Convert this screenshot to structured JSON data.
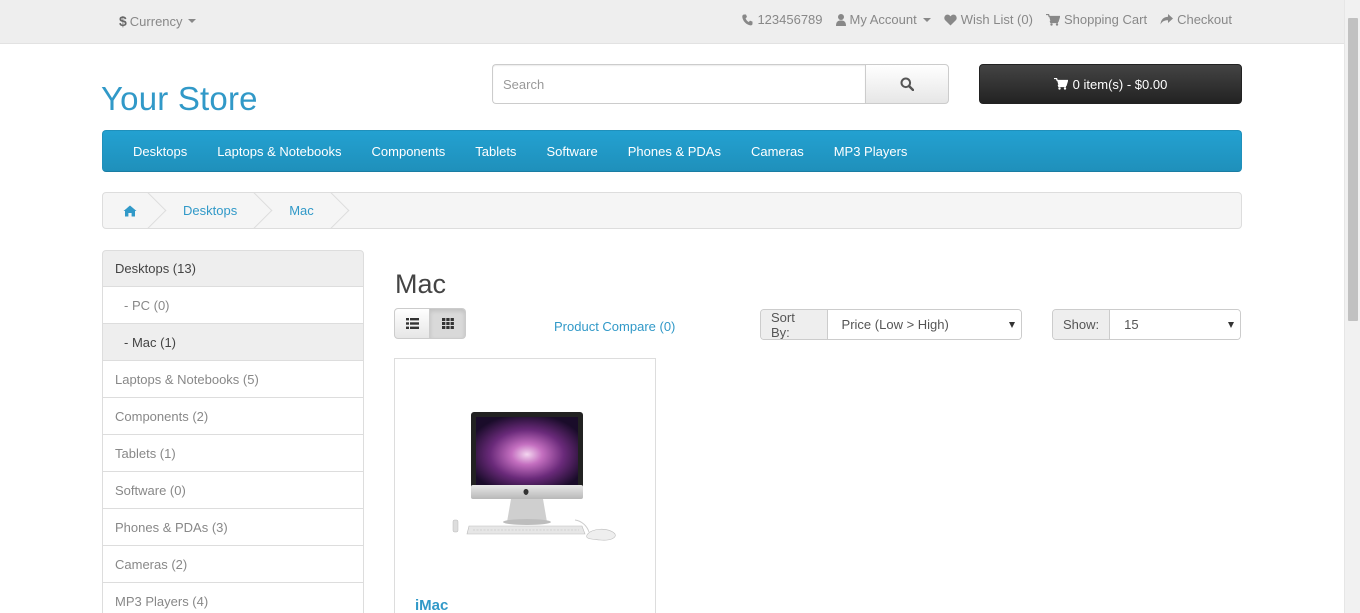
{
  "topbar": {
    "currency_symbol": "$",
    "currency_label": "Currency",
    "phone": "123456789",
    "my_account": "My Account",
    "wish_list": "Wish List (0)",
    "shopping_cart": "Shopping Cart",
    "checkout": "Checkout"
  },
  "header": {
    "logo": "Your Store",
    "search_placeholder": "Search",
    "cart_label": "0 item(s) - $0.00"
  },
  "menu": [
    "Desktops",
    "Laptops & Notebooks",
    "Components",
    "Tablets",
    "Software",
    "Phones & PDAs",
    "Cameras",
    "MP3 Players"
  ],
  "breadcrumb": [
    "Desktops",
    "Mac"
  ],
  "sidebar": [
    {
      "label": "Desktops (13)",
      "active": true,
      "sub": false
    },
    {
      "label": "- PC (0)",
      "active": false,
      "sub": true
    },
    {
      "label": "- Mac (1)",
      "active": true,
      "sub": true
    },
    {
      "label": "Laptops & Notebooks (5)",
      "active": false,
      "sub": false
    },
    {
      "label": "Components (2)",
      "active": false,
      "sub": false
    },
    {
      "label": "Tablets (1)",
      "active": false,
      "sub": false
    },
    {
      "label": "Software (0)",
      "active": false,
      "sub": false
    },
    {
      "label": "Phones & PDAs (3)",
      "active": false,
      "sub": false
    },
    {
      "label": "Cameras (2)",
      "active": false,
      "sub": false
    },
    {
      "label": "MP3 Players (4)",
      "active": false,
      "sub": false
    }
  ],
  "content": {
    "title": "Mac",
    "product_compare": "Product Compare (0)",
    "sort_label": "Sort By:",
    "sort_value": "Price (Low > High)",
    "show_label": "Show:",
    "show_value": "15"
  },
  "products": [
    {
      "name": "iMac",
      "image_icon": "imac-image"
    }
  ],
  "colors": {
    "accent": "#3199c8",
    "menu_bg": "#229ac8",
    "cart_bg": "#303030"
  }
}
